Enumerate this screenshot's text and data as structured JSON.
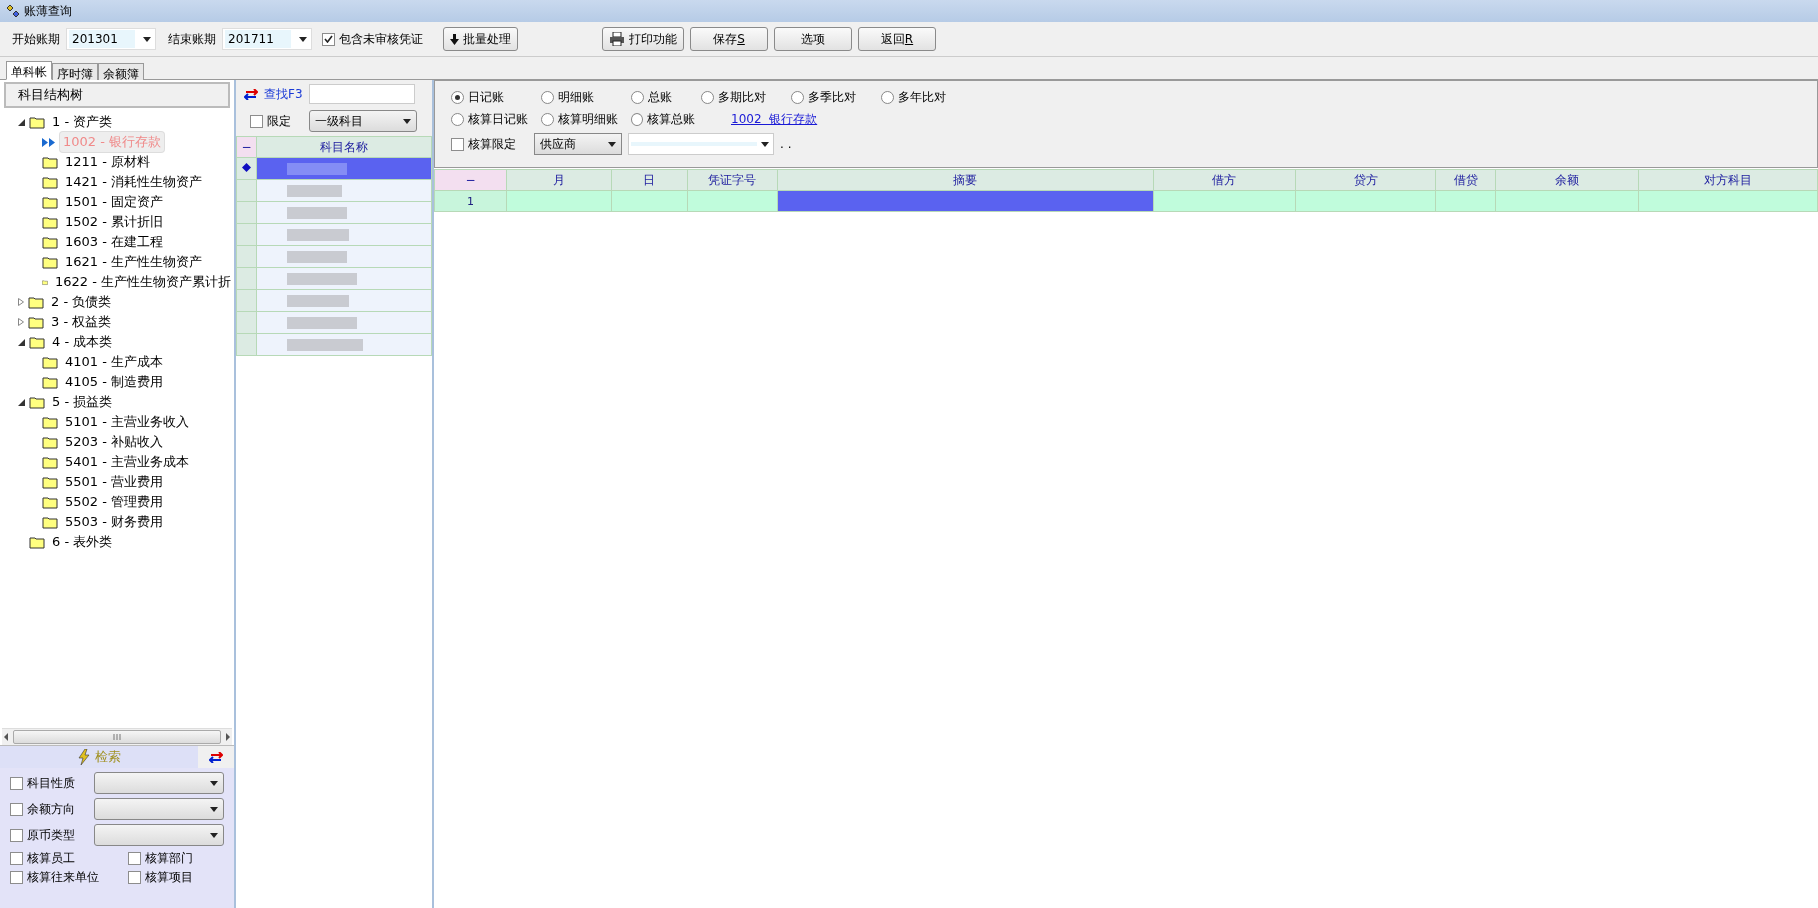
{
  "window": {
    "title": "账薄查询"
  },
  "toolbar": {
    "start_label": "开始账期",
    "start_value": "201301",
    "end_label": "结束账期",
    "end_value": "201711",
    "include_unaudited": {
      "label": "包含未审核凭证",
      "checked": true
    },
    "batch_button": "批量处理",
    "buttons": [
      {
        "label": "打印功能",
        "kind": "print"
      },
      {
        "label": "保存",
        "kind": "plain",
        "hotkey": "S"
      },
      {
        "label": "选项",
        "kind": "plain"
      },
      {
        "label": "返回",
        "kind": "plain",
        "hotkey": "R"
      }
    ]
  },
  "tabs": [
    {
      "label": "单科帐",
      "selected": true
    },
    {
      "label": "序时簿",
      "selected": false
    },
    {
      "label": "余额簿",
      "selected": false
    }
  ],
  "tree": {
    "header": "科目结构树",
    "items": [
      {
        "label": "1 - 资产类",
        "expanded": true,
        "selected": false,
        "children": [
          {
            "label": "1002 - 银行存款",
            "selected": true
          },
          {
            "label": "1211 - 原材料",
            "selected": false
          },
          {
            "label": "1421 - 消耗性生物资产",
            "selected": false
          },
          {
            "label": "1501 - 固定资产",
            "selected": false
          },
          {
            "label": "1502 - 累计折旧",
            "selected": false
          },
          {
            "label": "1603 - 在建工程",
            "selected": false
          },
          {
            "label": "1621 - 生产性生物资产",
            "selected": false
          },
          {
            "label": "1622 - 生产性生物资产累计折",
            "selected": false
          }
        ]
      },
      {
        "label": "2 - 负债类",
        "expanded": false,
        "selected": false
      },
      {
        "label": "3 - 权益类",
        "expanded": false,
        "selected": false
      },
      {
        "label": "4 - 成本类",
        "expanded": true,
        "selected": false,
        "children": [
          {
            "label": "4101 - 生产成本",
            "selected": false
          },
          {
            "label": "4105 - 制造费用",
            "selected": false
          }
        ]
      },
      {
        "label": "5 - 损益类",
        "expanded": true,
        "selected": false,
        "children": [
          {
            "label": "5101 - 主营业务收入",
            "selected": false
          },
          {
            "label": "5203 - 补贴收入",
            "selected": false
          },
          {
            "label": "5401 - 主营业务成本",
            "selected": false
          },
          {
            "label": "5501 - 营业费用",
            "selected": false
          },
          {
            "label": "5502 - 管理费用",
            "selected": false
          },
          {
            "label": "5503 - 财务费用",
            "selected": false
          }
        ]
      },
      {
        "label": "6 - 表外类",
        "selected": false
      }
    ]
  },
  "search": {
    "label": "检索",
    "selects": [
      {
        "label": "科目性质",
        "checked": false
      },
      {
        "label": "余额方向",
        "checked": false
      },
      {
        "label": "原币类型",
        "checked": false
      }
    ],
    "checks": [
      {
        "label": "核算员工",
        "checked": false
      },
      {
        "label": "核算部门",
        "checked": false
      },
      {
        "label": "核算往来单位",
        "checked": false
      },
      {
        "label": "核算项目",
        "checked": false
      }
    ]
  },
  "finder": {
    "find_label": "查找F3",
    "limit": {
      "label": "限定",
      "checked": false
    },
    "level_select": "一级科目",
    "list_header": "科目名称",
    "corner": "−",
    "rows": [
      {
        "selected": true
      },
      {
        "selected": false
      },
      {
        "selected": false
      },
      {
        "selected": false
      },
      {
        "selected": false
      },
      {
        "selected": false
      },
      {
        "selected": false
      },
      {
        "selected": false
      },
      {
        "selected": false
      }
    ]
  },
  "ledger": {
    "radio_rows": [
      [
        {
          "label": "日记账",
          "selected": true
        },
        {
          "label": "明细账",
          "selected": false
        },
        {
          "label": "总账",
          "selected": false
        },
        {
          "label": "多期比对",
          "selected": false
        },
        {
          "label": "多季比对",
          "selected": false
        },
        {
          "label": "多年比对",
          "selected": false
        }
      ],
      [
        {
          "label": "核算日记账",
          "selected": false
        },
        {
          "label": "核算明细账",
          "selected": false
        },
        {
          "label": "核算总账",
          "selected": false
        }
      ]
    ],
    "account_link": "1002  银行存款",
    "calc_limit": {
      "label": "核算限定",
      "checked": false
    },
    "calc_type": "供应商",
    "ellipsis": ". .",
    "corner": "−",
    "columns": [
      "月",
      "日",
      "凭证字号",
      "摘要",
      "借方",
      "贷方",
      "借贷",
      "余额",
      "对方科目"
    ],
    "rows": [
      {
        "number": "1",
        "cells": [
          {
            "selected": false
          },
          {
            "selected": false
          },
          {
            "selected": false
          },
          {
            "selected": true
          },
          {
            "selected": false
          },
          {
            "selected": false
          },
          {
            "selected": false
          },
          {
            "selected": false
          },
          {
            "selected": false
          }
        ]
      }
    ]
  }
}
